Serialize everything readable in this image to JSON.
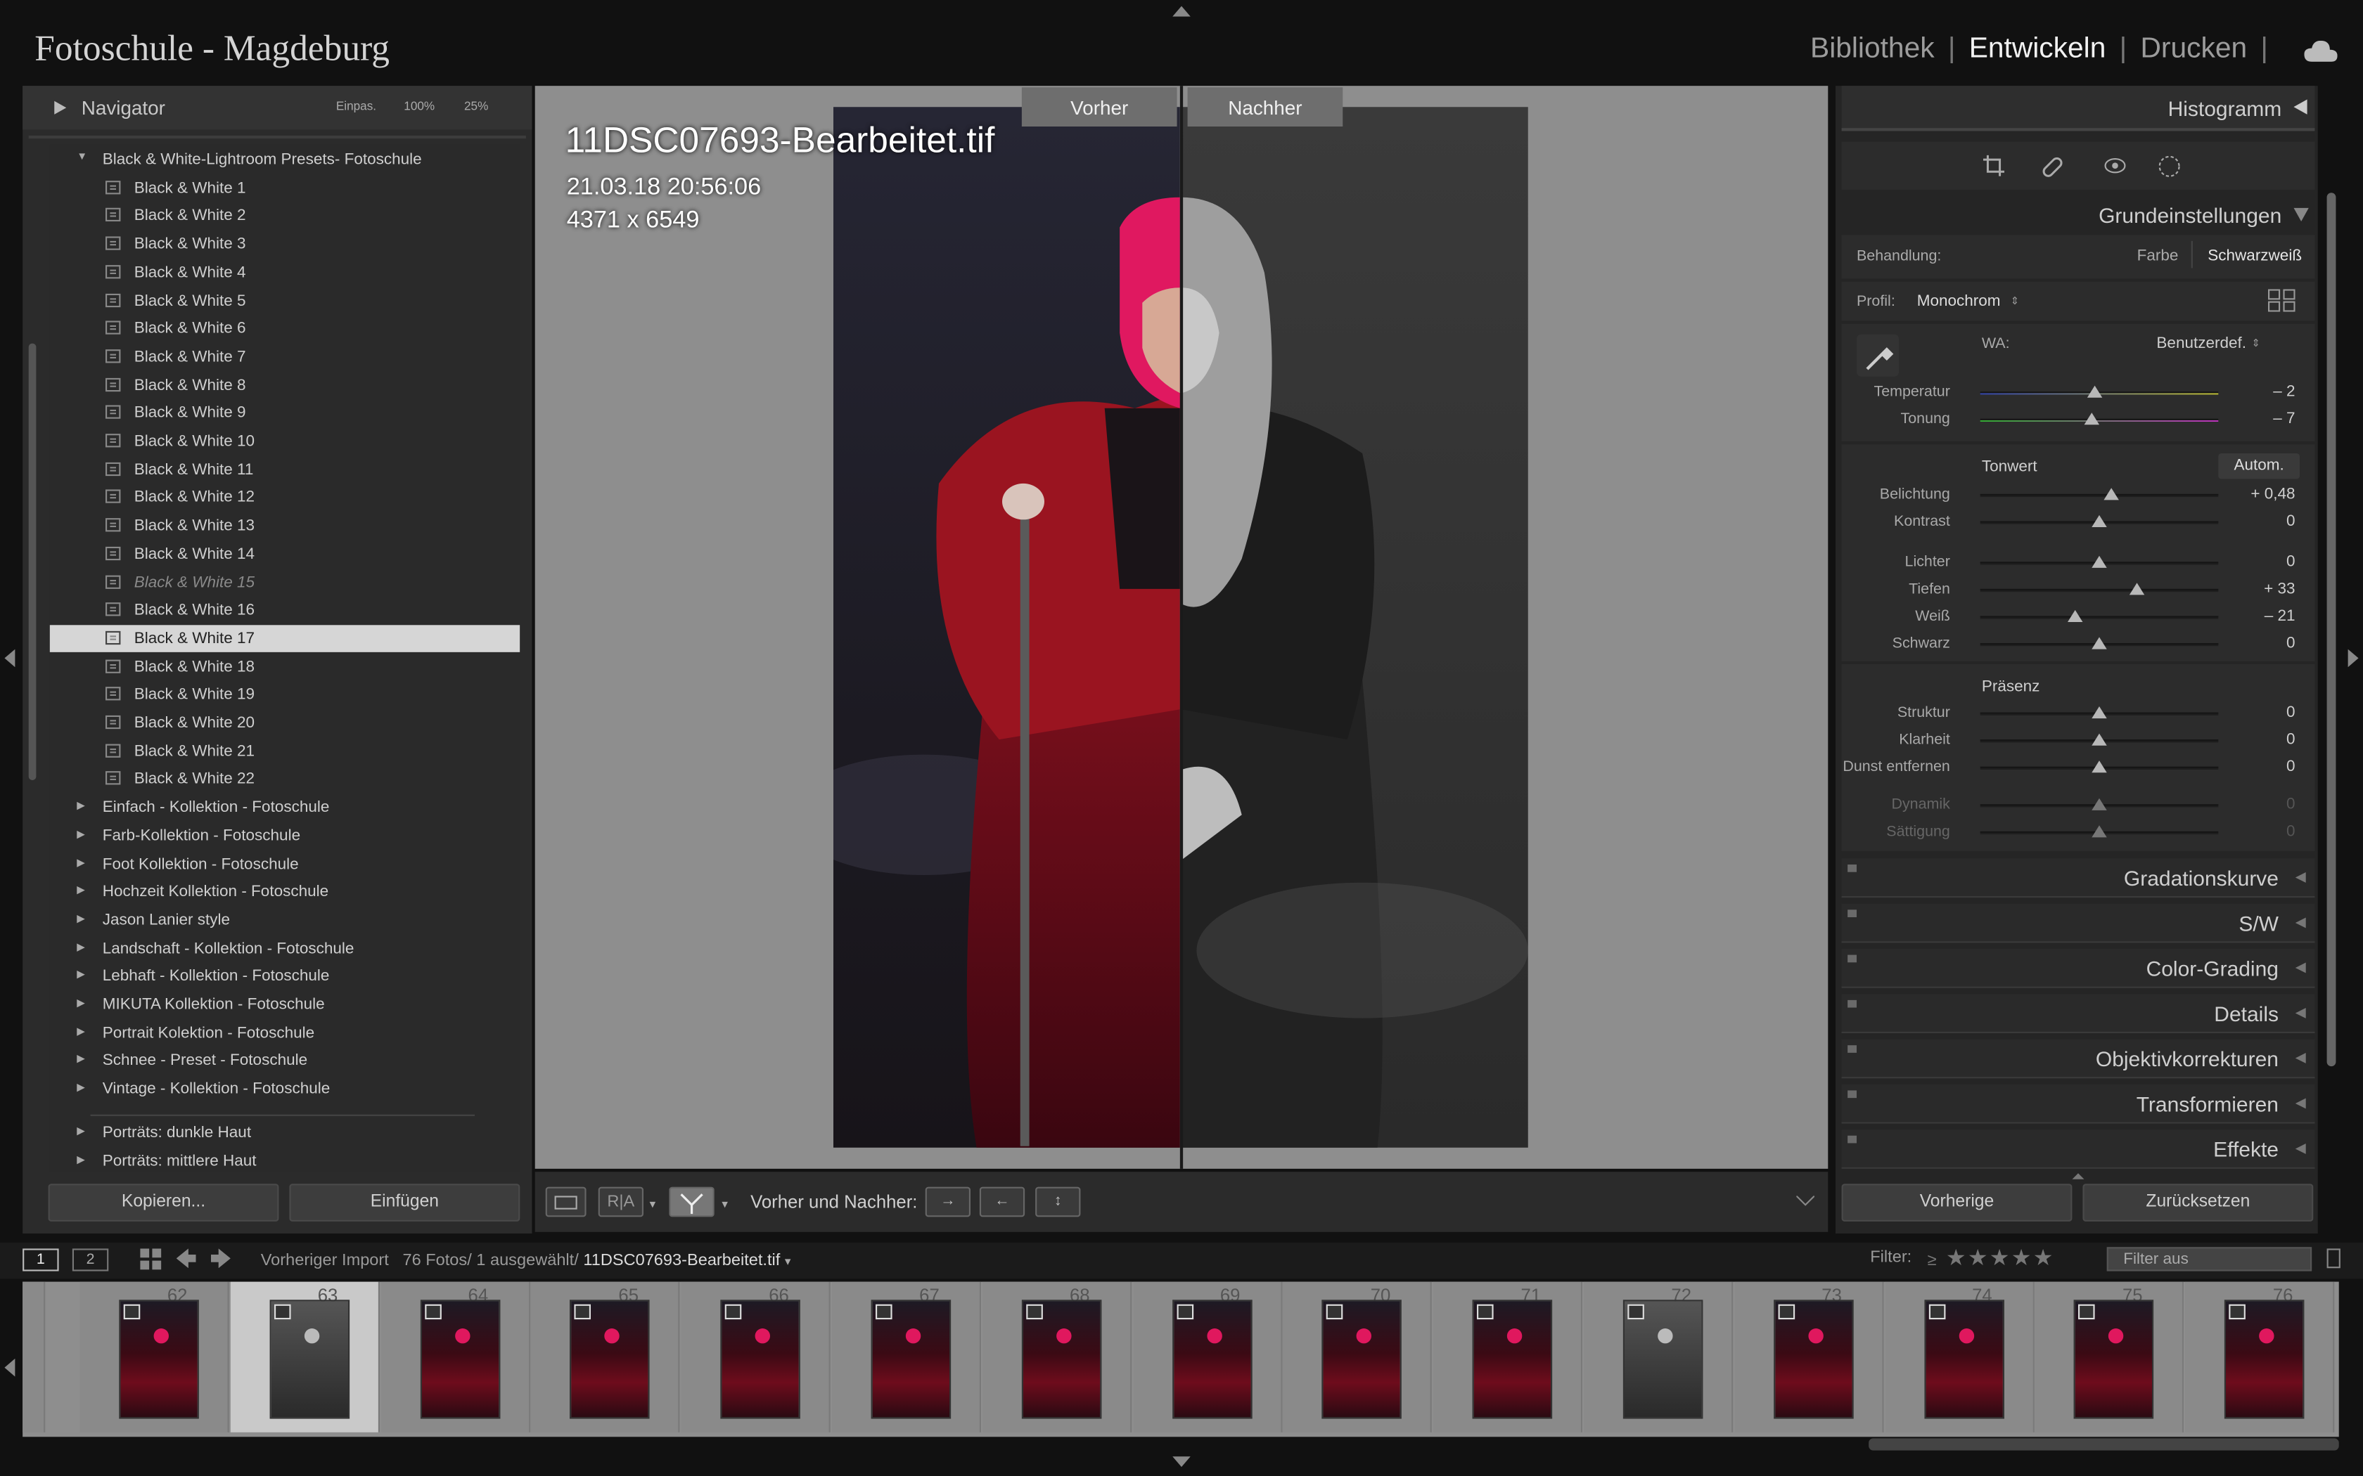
{
  "app": {
    "catalog": "Fotoschule - Magdeburg",
    "modules": [
      "Bibliothek",
      "Entwickeln",
      "Drucken"
    ],
    "active_module": "Entwickeln"
  },
  "navigator": {
    "title": "Navigator",
    "opts": [
      "Einpas.",
      "100%",
      "25%"
    ]
  },
  "presets": {
    "group_open": "Black & White-Lightroom Presets- Fotoschule",
    "items": [
      "Black & White 1",
      "Black & White 2",
      "Black & White 3",
      "Black & White 4",
      "Black & White 5",
      "Black & White 6",
      "Black & White 7",
      "Black & White 8",
      "Black & White 9",
      "Black & White 10",
      "Black & White 11",
      "Black & White 12",
      "Black & White 13",
      "Black & White 14",
      "Black & White 15",
      "Black & White 16",
      "Black & White 17",
      "Black & White 18",
      "Black & White 19",
      "Black & White 20",
      "Black & White 21",
      "Black & White 22"
    ],
    "selected": "Black & White 17",
    "groups": [
      "Einfach - Kollektion - Fotoschule",
      "Farb-Kollektion - Fotoschule",
      "Foot Kollektion - Fotoschule",
      "Hochzeit Kollektion - Fotoschule",
      "Jason Lanier style",
      "Landschaft - Kollektion - Fotoschule",
      "Lebhaft - Kollektion - Fotoschule",
      "MIKUTA Kollektion - Fotoschule",
      "Portrait Kolektion - Fotoschule",
      "Schnee - Preset - Fotoschule",
      "Vintage - Kollektion - Fotoschule"
    ],
    "groups2": [
      "Porträts: dunkle Haut",
      "Porträts: mittlere Haut"
    ]
  },
  "left_buttons": {
    "copy": "Kopieren...",
    "paste": "Einfügen"
  },
  "view": {
    "before": "Vorher",
    "after": "Nachher",
    "filename": "11DSC07693-Bearbeitet.tif",
    "datetime": "21.03.18 20:56:06",
    "dimensions": "4371 x 6549"
  },
  "toolbar": {
    "before_after_label": "Vorher und Nachher:"
  },
  "right": {
    "histogram": "Histogramm",
    "basic": "Grundeinstellungen",
    "treatment_label": "Behandlung:",
    "treatment_color": "Farbe",
    "treatment_bw": "Schwarzweiß",
    "profile_label": "Profil:",
    "profile_value": "Monochrom",
    "wb_label": "WA:",
    "wb_value": "Benutzerdef.",
    "tone_label": "Tonwert",
    "auto": "Autom.",
    "presence_label": "Präsenz",
    "sliders": [
      {
        "name": "Temperatur",
        "value": "– 2",
        "pos": 0.48
      },
      {
        "name": "Tonung",
        "value": "– 7",
        "pos": 0.47
      },
      {
        "name": "Belichtung",
        "value": "+ 0,48",
        "pos": 0.55
      },
      {
        "name": "Kontrast",
        "value": "0",
        "pos": 0.5
      },
      {
        "name": "Lichter",
        "value": "0",
        "pos": 0.5
      },
      {
        "name": "Tiefen",
        "value": "+ 33",
        "pos": 0.66
      },
      {
        "name": "Weiß",
        "value": "– 21",
        "pos": 0.4
      },
      {
        "name": "Schwarz",
        "value": "0",
        "pos": 0.5
      },
      {
        "name": "Struktur",
        "value": "0",
        "pos": 0.5
      },
      {
        "name": "Klarheit",
        "value": "0",
        "pos": 0.5
      },
      {
        "name": "Dunst entfernen",
        "value": "0",
        "pos": 0.5
      },
      {
        "name": "Dynamik",
        "value": "0",
        "pos": 0.5
      },
      {
        "name": "Sättigung",
        "value": "0",
        "pos": 0.5
      }
    ],
    "panels": [
      "Gradationskurve",
      "S/W",
      "Color-Grading",
      "Details",
      "Objektivkorrekturen",
      "Transformieren",
      "Effekte"
    ],
    "prev": "Vorherige",
    "reset": "Zurücksetzen"
  },
  "filmstrip": {
    "screens": [
      "1",
      "2"
    ],
    "source": "Vorheriger Import",
    "count": "76 Fotos/",
    "selected_count": "1 ausgewählt/",
    "file": "11DSC07693-Bearbeitet.tif",
    "filter_label": "Filter:",
    "filter_value": "Filter aus",
    "numbers": [
      "62",
      "63",
      "64",
      "65",
      "66",
      "67",
      "68",
      "69",
      "70",
      "71",
      "72",
      "73",
      "74",
      "75",
      "76"
    ],
    "bw": [
      false,
      true,
      false,
      false,
      false,
      false,
      false,
      false,
      false,
      false,
      true,
      false,
      false,
      false,
      false
    ]
  }
}
